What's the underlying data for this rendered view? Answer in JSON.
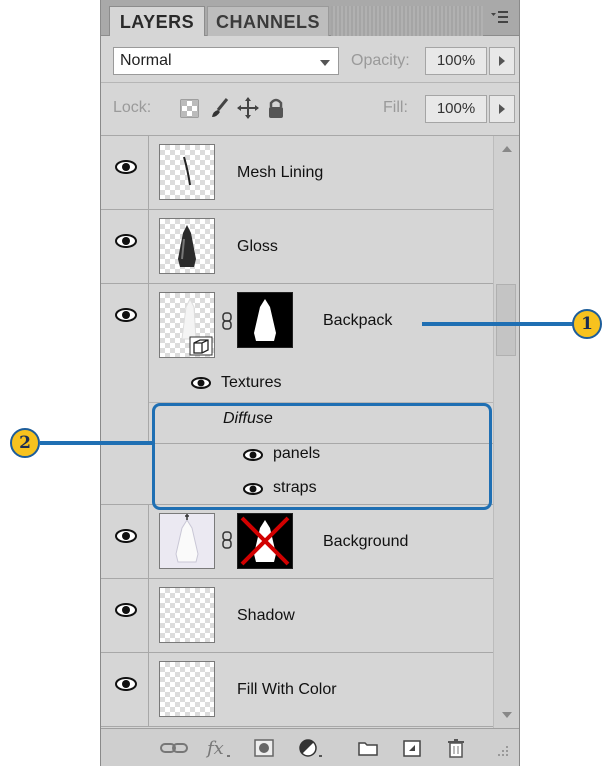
{
  "tabs": {
    "layers": "LAYERS",
    "channels": "CHANNELS"
  },
  "blend": {
    "mode": "Normal",
    "opacity_label": "Opacity:",
    "opacity_value": "100%"
  },
  "lock": {
    "label": "Lock:",
    "fill_label": "Fill:",
    "fill_value": "100%"
  },
  "layers": {
    "mesh_lining": "Mesh Lining",
    "gloss": "Gloss",
    "backpack": "Backpack",
    "textures": "Textures",
    "diffuse": "Diffuse",
    "panels": "panels",
    "straps": "straps",
    "background": "Background",
    "shadow": "Shadow",
    "fill_with_color": "Fill With Color"
  },
  "callouts": {
    "one": "1",
    "two": "2"
  },
  "colors": {
    "callout_fill": "#f7c21e",
    "callout_line": "#1f6fb3",
    "panel_bg": "#d6d6d6",
    "mask_cross": "#d10000"
  },
  "icons": {
    "toolbar": [
      "link-icon",
      "fx-icon",
      "add-mask-icon",
      "adjustment-layer-icon",
      "new-group-icon",
      "new-layer-icon",
      "trash-icon"
    ],
    "lock": [
      "lock-transparent-icon",
      "lock-image-icon",
      "lock-position-icon",
      "lock-all-icon"
    ]
  }
}
